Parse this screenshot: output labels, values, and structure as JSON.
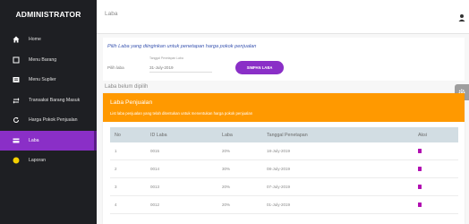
{
  "sidebar": {
    "brand": "ADMINISTRATOR",
    "items": [
      {
        "label": "Home",
        "icon": "home-icon"
      },
      {
        "label": "Menu Barang",
        "icon": "box-icon"
      },
      {
        "label": "Menu Suplier",
        "icon": "list-icon"
      },
      {
        "label": "Transaksi Barang Masuk",
        "icon": "transfer-icon"
      },
      {
        "label": "Harga Pokok Penjualan",
        "icon": "refresh-icon"
      },
      {
        "label": "Laba",
        "icon": "card-icon",
        "active": true
      },
      {
        "label": "Laporan",
        "icon": "report-icon"
      }
    ]
  },
  "header": {
    "title": "Laba",
    "user_icon": "user-icon"
  },
  "form": {
    "instruction": "Pilih Laba yang diinginkan untuk penetapan harga pokok penjualan",
    "laba_label": "Pilih laba",
    "date_label": "Tanggal Penetapan Laba",
    "date_value": "31-July-2019",
    "save_button": "SIMPAN LABA"
  },
  "status": "Laba belum dipilih",
  "panel": {
    "title": "Laba Penjualan",
    "subtitle": "List laba penjualan yang telah ditentukan untuk menentukan harga pokok penjualan"
  },
  "table": {
    "headers": [
      "No",
      "ID Laba",
      "Laba",
      "Tanggal Penetapan",
      "Aksi"
    ],
    "rows": [
      [
        "1",
        "0015",
        "20%",
        "18-July-2019"
      ],
      [
        "2",
        "0014",
        "30%",
        "08-July-2019"
      ],
      [
        "3",
        "0013",
        "20%",
        "07-July-2019"
      ],
      [
        "4",
        "0012",
        "20%",
        "01-July-2019"
      ]
    ]
  },
  "colors": {
    "sidebar": "#1e1f23",
    "accent": "#8a2fc7",
    "panel_header": "#ff9900",
    "delete_icon": "#b10fb1"
  }
}
